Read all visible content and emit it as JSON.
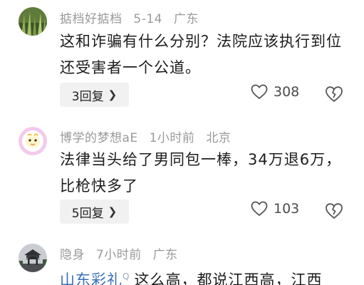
{
  "comments": [
    {
      "username": "掂档好掂档",
      "date": "5-14",
      "location": "广东",
      "text": "这和诈骗有什么分别？法院应该执行到位还受害者一个公道。",
      "reply_label": "3回复",
      "likes": "308"
    },
    {
      "username": "博学的梦想aE",
      "date": "1小时前",
      "location": "北京",
      "text": "法律当头给了男同包一棒，34万退6万，比枪快多了",
      "reply_label": "5回复",
      "likes": "103"
    },
    {
      "username": "隐身",
      "date": "7小时前",
      "location": "广东",
      "tag_link": "山东彩礼",
      "text": "这么高，都说江西高，江西"
    }
  ],
  "icons": {
    "like": "heart-outline-icon",
    "dislike": "broken-heart-icon",
    "reply_chevron": "chevron-right-icon",
    "search_tag": "search-small-icon"
  },
  "colors": {
    "link": "#3a6fb8",
    "meta": "#9a9a9a",
    "reply_bg": "#f1f1f1"
  }
}
